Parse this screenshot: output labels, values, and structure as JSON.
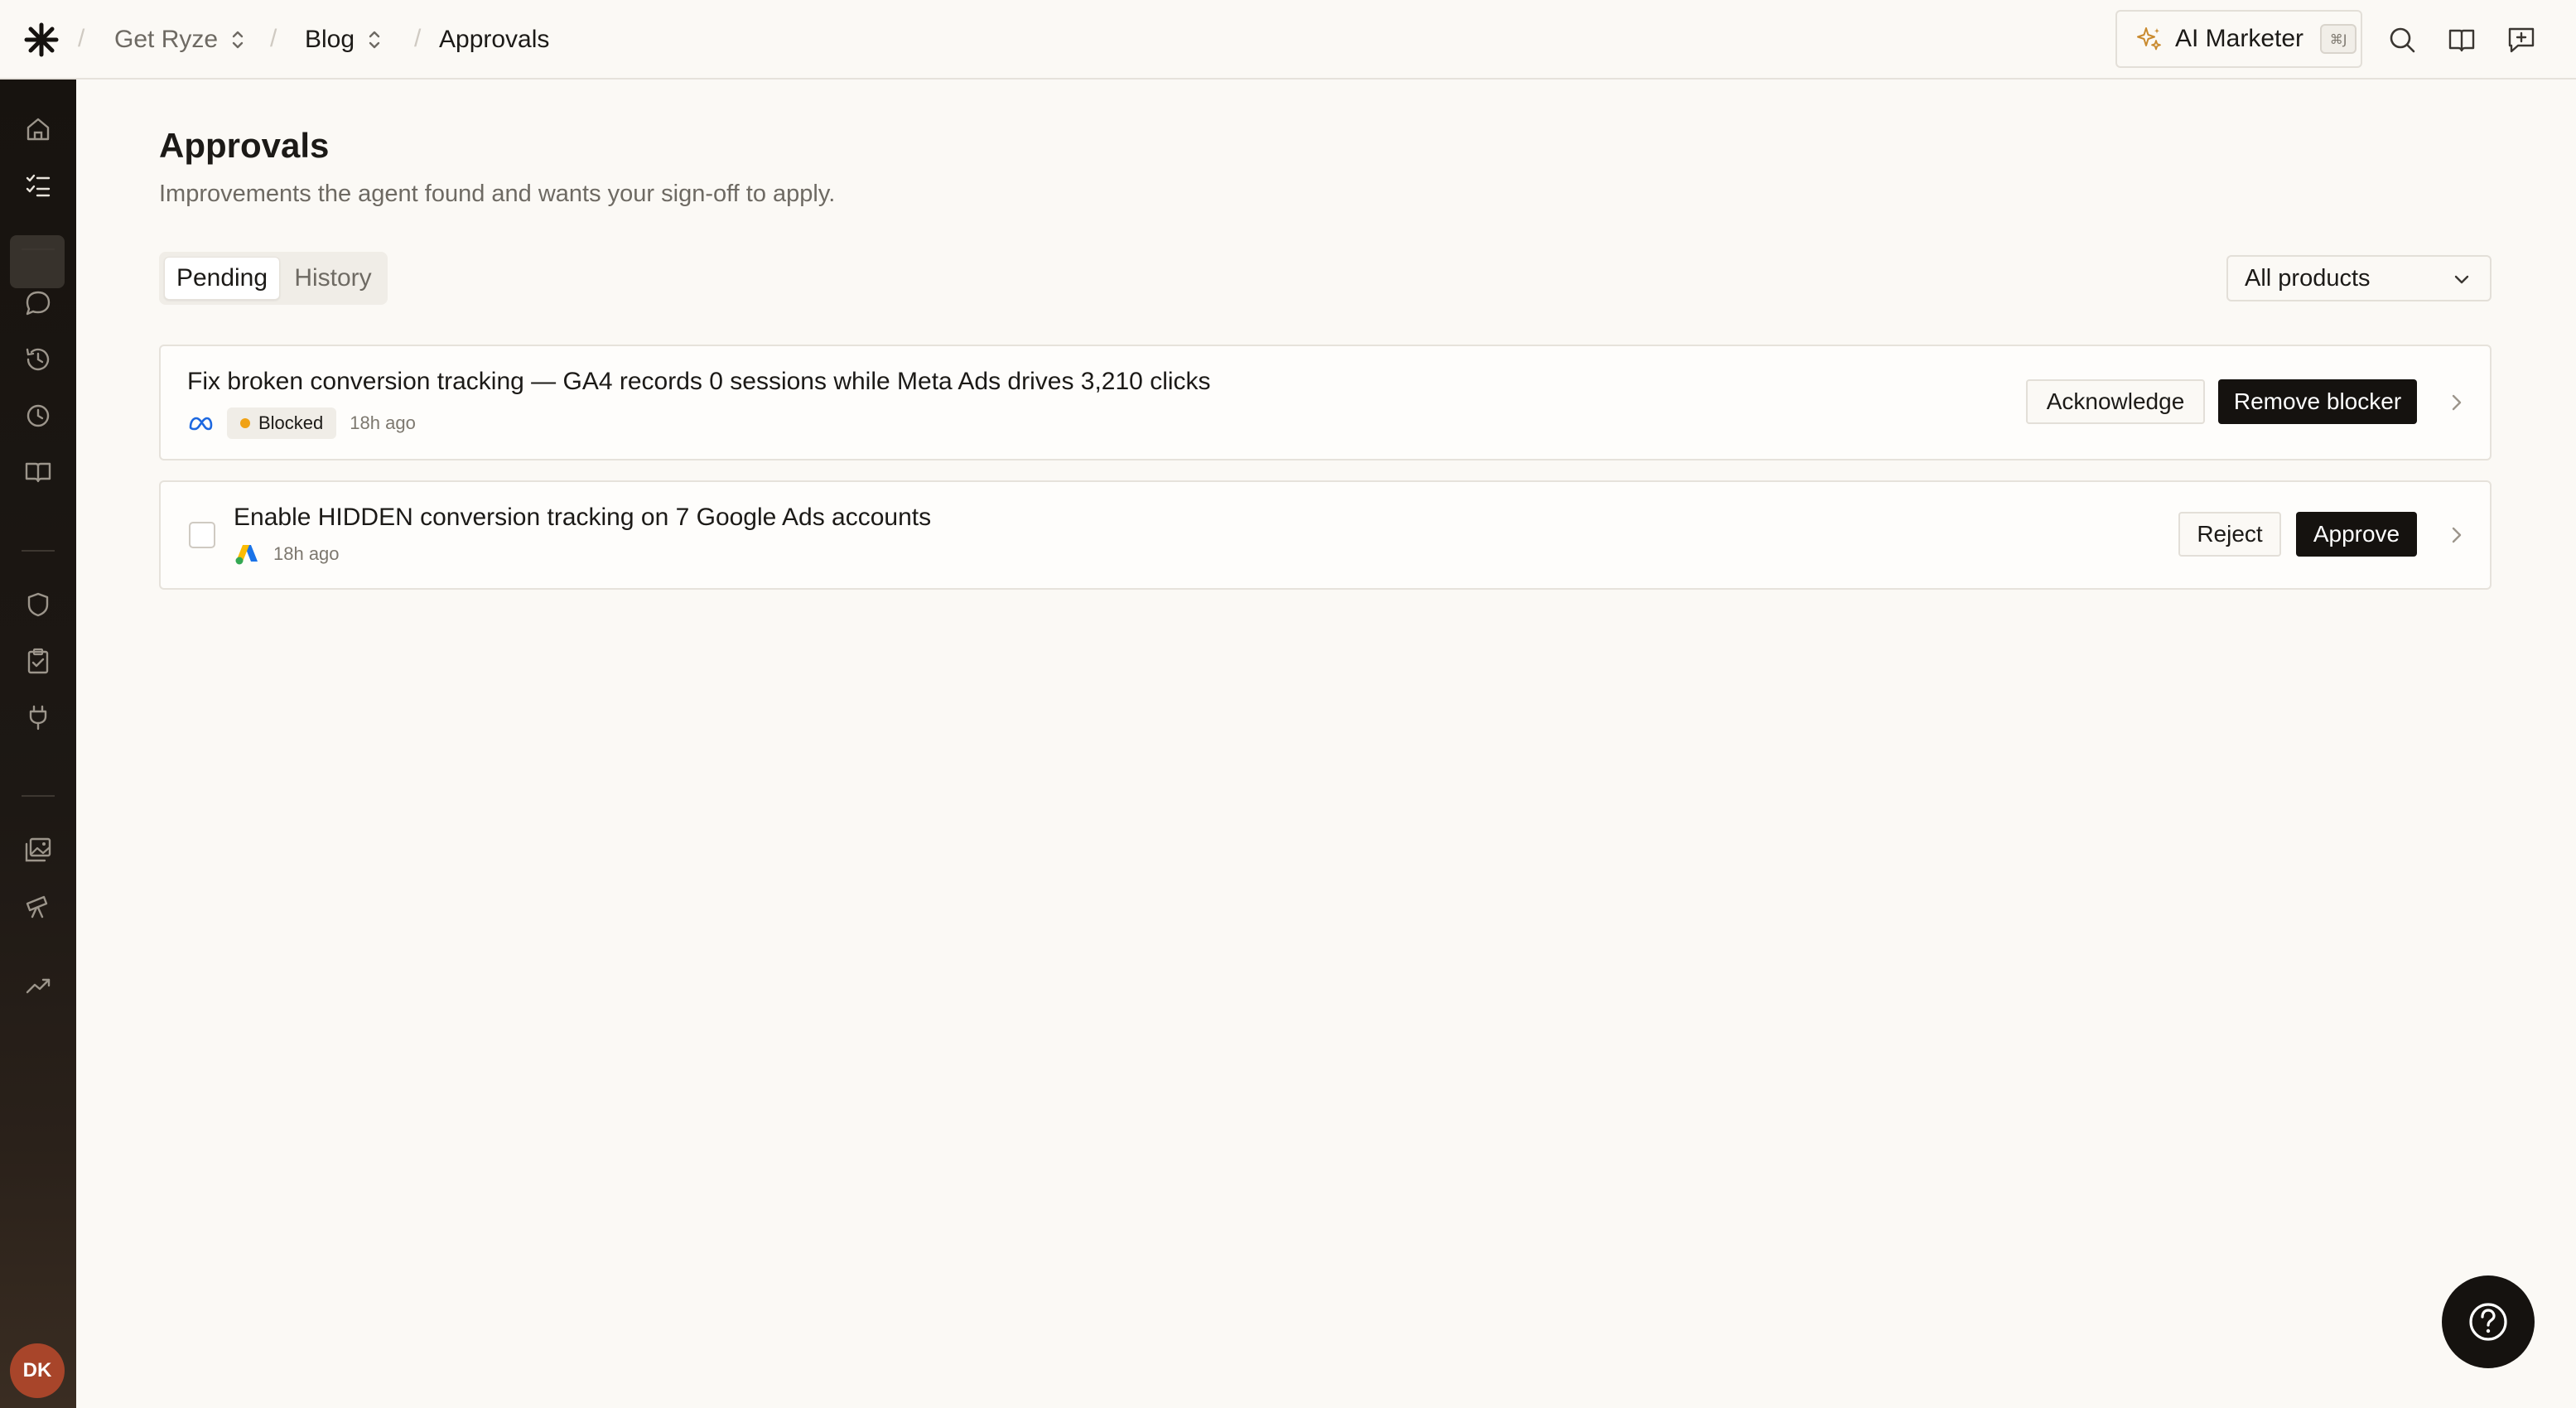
{
  "header": {
    "breadcrumbs": [
      {
        "label": "Get Ryze",
        "has_switcher": true
      },
      {
        "label": "Blog",
        "has_switcher": true
      },
      {
        "label": "Approvals",
        "has_switcher": false
      }
    ],
    "ai_marketer": {
      "label": "AI Marketer",
      "shortcut": "⌘J"
    },
    "icons": [
      "search-icon",
      "book-icon",
      "feedback-icon"
    ]
  },
  "sidebar": {
    "items": [
      {
        "icon": "home-icon",
        "active": false
      },
      {
        "icon": "checklist-icon",
        "active": true
      },
      {
        "icon": "chat-icon",
        "active": false
      },
      {
        "icon": "history-icon",
        "active": false
      },
      {
        "icon": "clock-icon",
        "active": false
      },
      {
        "icon": "book-open-icon",
        "active": false
      },
      {
        "icon": "shield-icon",
        "active": false
      },
      {
        "icon": "clipboard-check-icon",
        "active": false
      },
      {
        "icon": "plug-icon",
        "active": false
      },
      {
        "icon": "images-icon",
        "active": false
      },
      {
        "icon": "telescope-icon",
        "active": false
      },
      {
        "icon": "trending-up-icon",
        "active": false
      }
    ],
    "avatar_initials": "DK"
  },
  "page": {
    "title": "Approvals",
    "subtitle": "Improvements the agent found and wants your sign-off to apply."
  },
  "tabs": [
    {
      "label": "Pending",
      "active": true
    },
    {
      "label": "History",
      "active": false
    }
  ],
  "filter": {
    "selected": "All products"
  },
  "approvals": [
    {
      "title": "Fix broken conversion tracking — GA4 records 0 sessions while Meta Ads drives 3,210 clicks",
      "platform_icon": "meta-icon",
      "status": "Blocked",
      "status_color": "#f0a216",
      "time": "18h ago",
      "secondary_action": "Acknowledge",
      "primary_action": "Remove blocker"
    },
    {
      "title": "Enable HIDDEN conversion tracking on 7 Google Ads accounts",
      "platform_icon": "google-ads-icon",
      "time": "18h ago",
      "secondary_action": "Reject",
      "primary_action": "Approve"
    }
  ],
  "colors": {
    "background": "#fbf9f5",
    "sidebar": "#17130f",
    "primary_button": "#15120f",
    "avatar": "#a8452a"
  }
}
